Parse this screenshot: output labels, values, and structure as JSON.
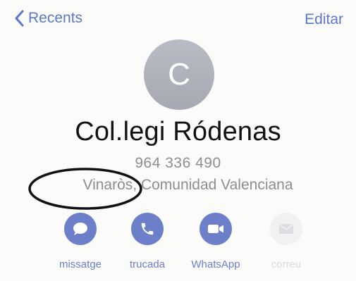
{
  "header": {
    "back_label": "Recents",
    "edit_label": "Editar"
  },
  "contact": {
    "avatar_initial": "C",
    "name": "Col.legi Ródenas",
    "phone": "964 336 490",
    "location": "Vinaròs, Comunidad Valenciana"
  },
  "actions": [
    {
      "label": "missatge",
      "icon": "message-icon",
      "enabled": true
    },
    {
      "label": "trucada",
      "icon": "phone-icon",
      "enabled": true
    },
    {
      "label": "WhatsApp",
      "icon": "video-icon",
      "enabled": true
    },
    {
      "label": "correu",
      "icon": "mail-icon",
      "enabled": false
    }
  ],
  "colors": {
    "accent": "#5b79c6",
    "action_button": "#6d7fc9",
    "avatar": "#adb0b8",
    "secondary_text": "#8e8e8e"
  }
}
